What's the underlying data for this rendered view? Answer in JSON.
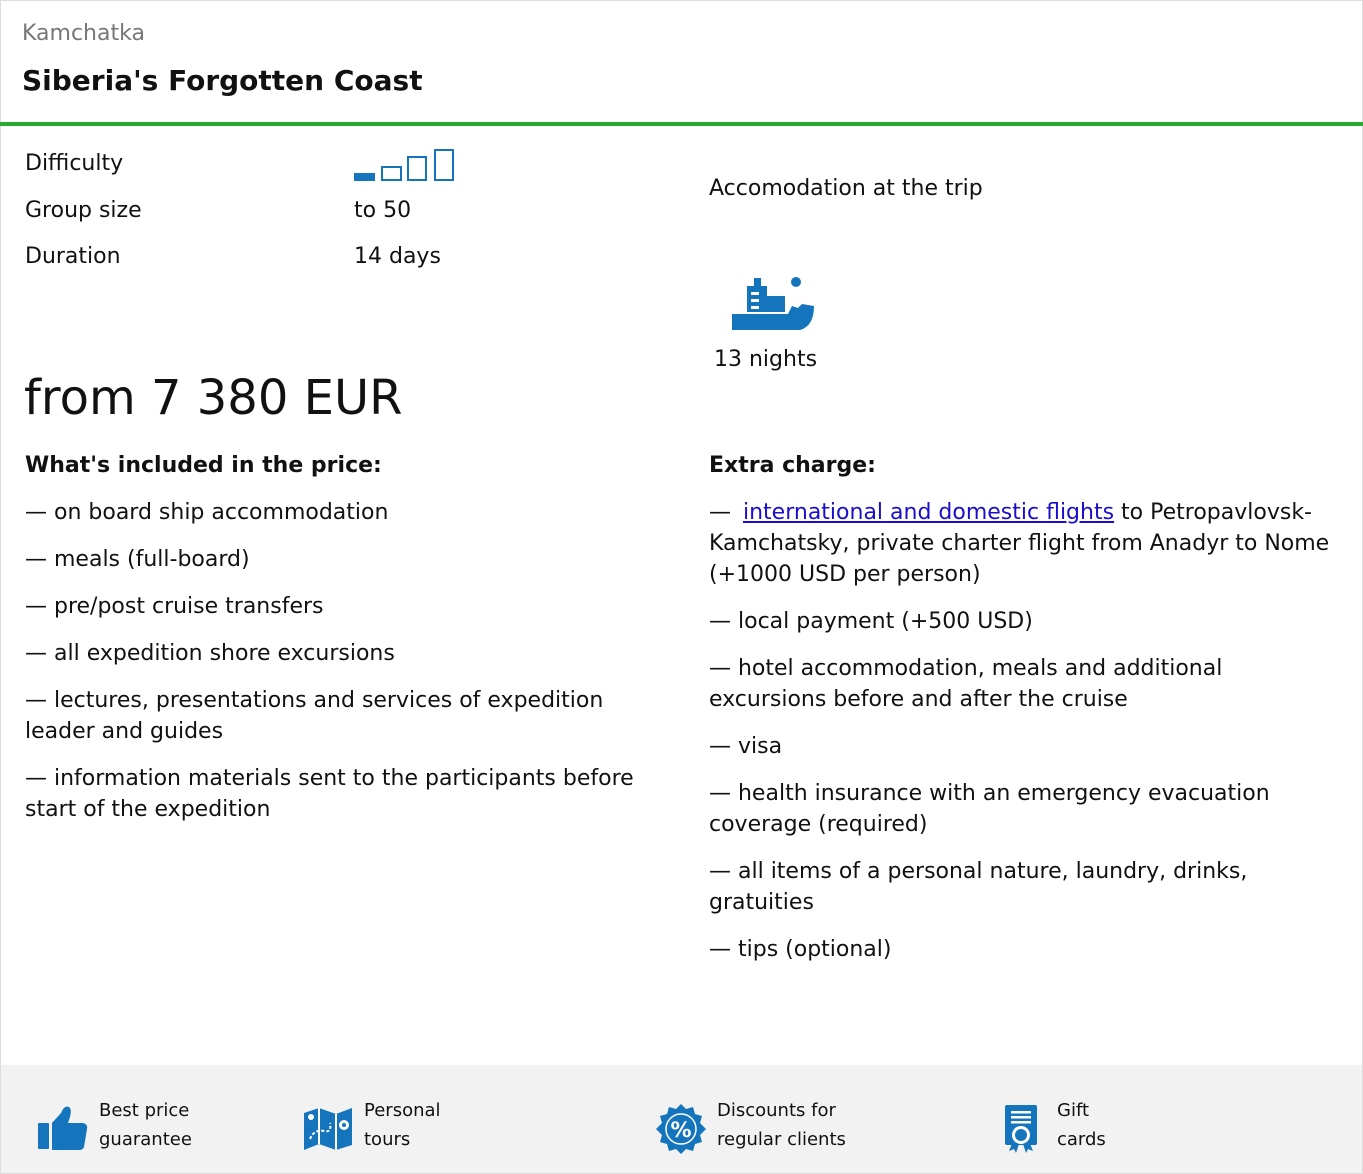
{
  "header": {
    "region": "Kamchatka",
    "title": "Siberia's Forgotten Coast"
  },
  "details": {
    "difficulty_label": "Difficulty",
    "difficulty_level": 1,
    "difficulty_max": 4,
    "group_size_label": "Group size",
    "group_size_value": "to 50",
    "duration_label": "Duration",
    "duration_value": "14 days"
  },
  "accommodation": {
    "title": "Accomodation at the trip",
    "icon": "ship-icon",
    "nights": "13 nights"
  },
  "price": "from 7 380 EUR",
  "included": {
    "heading": "What's included in the price:",
    "items": [
      "— on board ship accommodation",
      "— meals (full-board)",
      "— pre/post cruise transfers",
      "— all expedition shore excursions",
      "— lectures, presentations and services of expedition leader and guides",
      "— information materials sent to the participants before start of the expedition"
    ]
  },
  "extra": {
    "heading": "Extra charge:",
    "first_prefix": "—",
    "first_link": "international and domestic flights",
    "first_suffix": " to Petropavlovsk-Kamchatsky, private charter flight from Anadyr to Nome (+1000 USD per person)",
    "items": [
      "— local payment (+500 USD)",
      "— hotel accommodation, meals and additional excursions before and after the cruise",
      "— visa",
      "— health insurance with an emergency evacuation coverage (required)",
      "— all items of a personal nature, laundry, drinks, gratuities",
      "— tips (optional)"
    ]
  },
  "footer": {
    "features": [
      {
        "icon": "thumbs-up-icon",
        "line1": "Best price",
        "line2": "guarantee"
      },
      {
        "icon": "map-icon",
        "line1": "Personal",
        "line2": "tours"
      },
      {
        "icon": "discount-badge-icon",
        "line1": "Discounts for",
        "line2": "regular clients"
      },
      {
        "icon": "gift-card-icon",
        "line1": "Gift",
        "line2": "cards"
      }
    ]
  },
  "colors": {
    "accent_green": "#28a932",
    "icon_blue": "#1474bc",
    "link": "#1a0dcc"
  }
}
